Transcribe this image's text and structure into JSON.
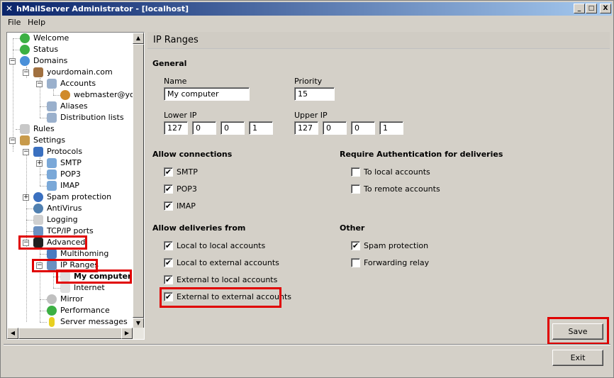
{
  "window": {
    "title": "hMailServer Administrator - [localhost]",
    "min": "_",
    "max": "□",
    "close": "X"
  },
  "menu": [
    "File",
    "Help"
  ],
  "tree": [
    {
      "label": "Welcome",
      "bold": false
    },
    {
      "label": "Status",
      "bold": false
    },
    {
      "label": "Domains",
      "bold": false
    },
    {
      "label": "yourdomain.com",
      "bold": false
    },
    {
      "label": "Accounts",
      "bold": false
    },
    {
      "label": "webmaster@you",
      "bold": false
    },
    {
      "label": "Aliases",
      "bold": false
    },
    {
      "label": "Distribution lists",
      "bold": false
    },
    {
      "label": "Rules",
      "bold": false
    },
    {
      "label": "Settings",
      "bold": false
    },
    {
      "label": "Protocols",
      "bold": false
    },
    {
      "label": "SMTP",
      "bold": false
    },
    {
      "label": "POP3",
      "bold": false
    },
    {
      "label": "IMAP",
      "bold": false
    },
    {
      "label": "Spam protection",
      "bold": false
    },
    {
      "label": "AntiVirus",
      "bold": false
    },
    {
      "label": "Logging",
      "bold": false
    },
    {
      "label": "TCP/IP ports",
      "bold": false
    },
    {
      "label": "Advanced",
      "bold": false
    },
    {
      "label": "Multihoming",
      "bold": false
    },
    {
      "label": "IP Ranges",
      "bold": false
    },
    {
      "label": "My computer",
      "bold": true
    },
    {
      "label": "Internet",
      "bold": false
    },
    {
      "label": "Mirror",
      "bold": false
    },
    {
      "label": "Performance",
      "bold": false
    },
    {
      "label": "Server messages",
      "bold": false
    }
  ],
  "page": {
    "title": "IP Ranges",
    "general": "General",
    "name_label": "Name",
    "name_value": "My computer",
    "priority_label": "Priority",
    "priority_value": "15",
    "lower_ip_label": "Lower IP",
    "lower_ip": [
      "127",
      "0",
      "0",
      "1"
    ],
    "upper_ip_label": "Upper IP",
    "upper_ip": [
      "127",
      "0",
      "0",
      "1"
    ],
    "allow_connections": "Allow connections",
    "conn": [
      {
        "label": "SMTP",
        "checked": true
      },
      {
        "label": "POP3",
        "checked": true
      },
      {
        "label": "IMAP",
        "checked": true
      }
    ],
    "require_auth": "Require Authentication for deliveries",
    "auth": [
      {
        "label": "To local accounts",
        "checked": false
      },
      {
        "label": "To remote accounts",
        "checked": false
      }
    ],
    "allow_deliveries": "Allow deliveries from",
    "deliv": [
      {
        "label": "Local to local accounts",
        "checked": true
      },
      {
        "label": "Local to external accounts",
        "checked": true
      },
      {
        "label": "External to local accounts",
        "checked": true
      },
      {
        "label": "External to external accounts",
        "checked": true
      }
    ],
    "other": "Other",
    "other_items": [
      {
        "label": "Spam protection",
        "checked": true
      },
      {
        "label": "Forwarding relay",
        "checked": false
      }
    ],
    "save": "Save",
    "exit": "Exit",
    "check_mark": "✔"
  },
  "colors": {
    "highlight": "#e00000",
    "titlebar": "#0a246a"
  }
}
